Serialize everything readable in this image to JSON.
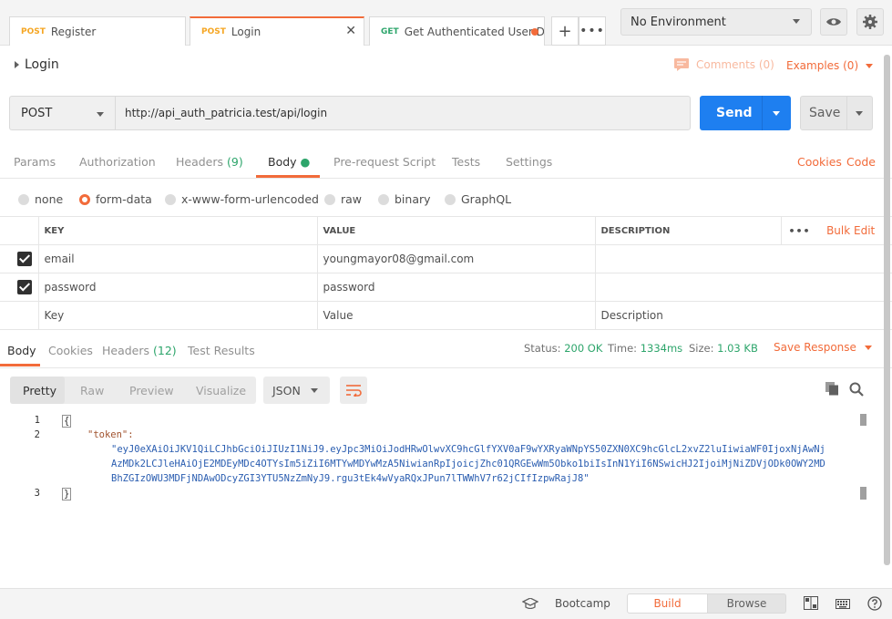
{
  "tabs": [
    {
      "method": "POST",
      "name": "Register"
    },
    {
      "method": "POST",
      "name": "Login"
    },
    {
      "method": "GET",
      "name": "Get Authenticated User D..."
    }
  ],
  "environment": {
    "selected": "No Environment"
  },
  "request": {
    "title": "Login",
    "comments_label": "Comments (0)",
    "examples_label": "Examples (0)",
    "method": "POST",
    "url": "http://api_auth_patricia.test/api/login",
    "send_label": "Send",
    "save_label": "Save"
  },
  "request_tabs": {
    "params": "Params",
    "authorization": "Authorization",
    "headers": "Headers",
    "headers_count": "(9)",
    "body": "Body",
    "pre_request": "Pre-request Script",
    "tests": "Tests",
    "settings": "Settings",
    "cookies": "Cookies",
    "code": "Code"
  },
  "body_types": {
    "none": "none",
    "form_data": "form-data",
    "urlencoded": "x-www-form-urlencoded",
    "raw": "raw",
    "binary": "binary",
    "graphql": "GraphQL",
    "selected": "form-data"
  },
  "params_table": {
    "headers": {
      "key": "KEY",
      "value": "VALUE",
      "description": "DESCRIPTION",
      "bulk_edit": "Bulk Edit"
    },
    "rows": [
      {
        "key": "email",
        "value": "youngmayor08@gmail.com",
        "description": ""
      },
      {
        "key": "password",
        "value": "password",
        "description": ""
      }
    ],
    "placeholders": {
      "key": "Key",
      "value": "Value",
      "description": "Description"
    }
  },
  "response": {
    "tabs": {
      "body": "Body",
      "cookies": "Cookies",
      "headers": "Headers",
      "headers_count": "(12)",
      "test_results": "Test Results"
    },
    "status_label": "Status:",
    "status_value": "200 OK",
    "time_label": "Time:",
    "time_value": "1334ms",
    "size_label": "Size:",
    "size_value": "1.03 KB",
    "save_response": "Save Response",
    "formats": {
      "pretty": "Pretty",
      "raw": "Raw",
      "preview": "Preview",
      "visualize": "Visualize"
    },
    "language": "JSON",
    "lines": [
      "1",
      "2",
      "3"
    ],
    "code": {
      "open_brace": "{",
      "token_key": "\"token\":",
      "token_line1": "\"eyJ0eXAiOiJKV1QiLCJhbGciOiJIUzI1NiJ9.eyJpc3MiOiJodHRwOlwvXC9hcGlfYXV0aF9wYXRyaWNpYS50ZXN0XC9hcGlcL2xvZ2luIiwiaWF0IjoxNjAwNj",
      "token_line2": "AzMDk2LCJleHAiOjE2MDEyMDc4OTYsIm5iZiI6MTYwMDYwMzA5NiwianRpIjoicjZhc01QRGEwWm5Obko1biIsInN1YiI6NSwicHJ2IjoiMjNiZDVjODk0OWY2MD",
      "token_line3": "BhZGIzOWU3MDFjNDAwODcyZGI3YTU5NzZmNyJ9.rgu3tEk4wVyaRQxJPun7lTWWhV7r62jCIfIzpwRajJ8\"",
      "close_brace": "}"
    }
  },
  "statusbar": {
    "bootcamp": "Bootcamp",
    "build": "Build",
    "browse": "Browse"
  },
  "colors": {
    "accent": "#f26b3a",
    "send": "#1e7ff0",
    "success": "#2da56b",
    "post": "#f5a623",
    "get": "#2da56b"
  },
  "icons": [
    "plus-icon",
    "more-icon",
    "eye-icon",
    "gear-icon",
    "comment-icon",
    "copy-icon",
    "search-icon",
    "wrap-icon",
    "bootcamp-icon",
    "layout-icon",
    "keyboard-icon",
    "help-icon"
  ]
}
